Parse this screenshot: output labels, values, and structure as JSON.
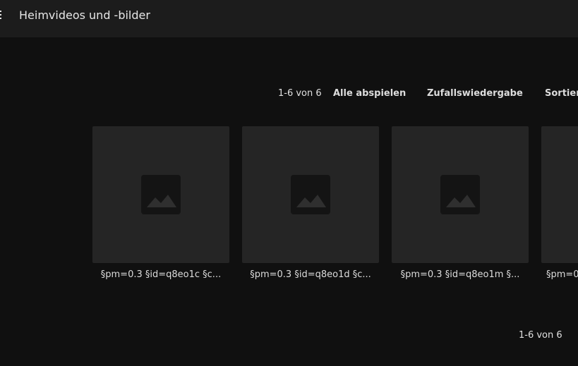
{
  "header": {
    "title": "Heimvideos und -bilder",
    "menu_icon": "menu-icon"
  },
  "toolbar": {
    "count": "1-6 von 6",
    "play_all": "Alle abspielen",
    "shuffle": "Zufallswiedergabe",
    "sort": "Sortier"
  },
  "items": [
    {
      "caption": "§pm=0.3 §id=q8eo1c §c...",
      "icon": "image-icon"
    },
    {
      "caption": "§pm=0.3 §id=q8eo1d §c...",
      "icon": "image-icon"
    },
    {
      "caption": "§pm=0.3 §id=q8eo1m §...",
      "icon": "image-icon"
    },
    {
      "caption": "§pm=0",
      "icon": "image-icon"
    }
  ],
  "footer": {
    "count": "1-6 von 6"
  },
  "colors": {
    "background": "#101010",
    "header": "#1c1c1c",
    "card": "#252525",
    "icon": "#141414"
  }
}
